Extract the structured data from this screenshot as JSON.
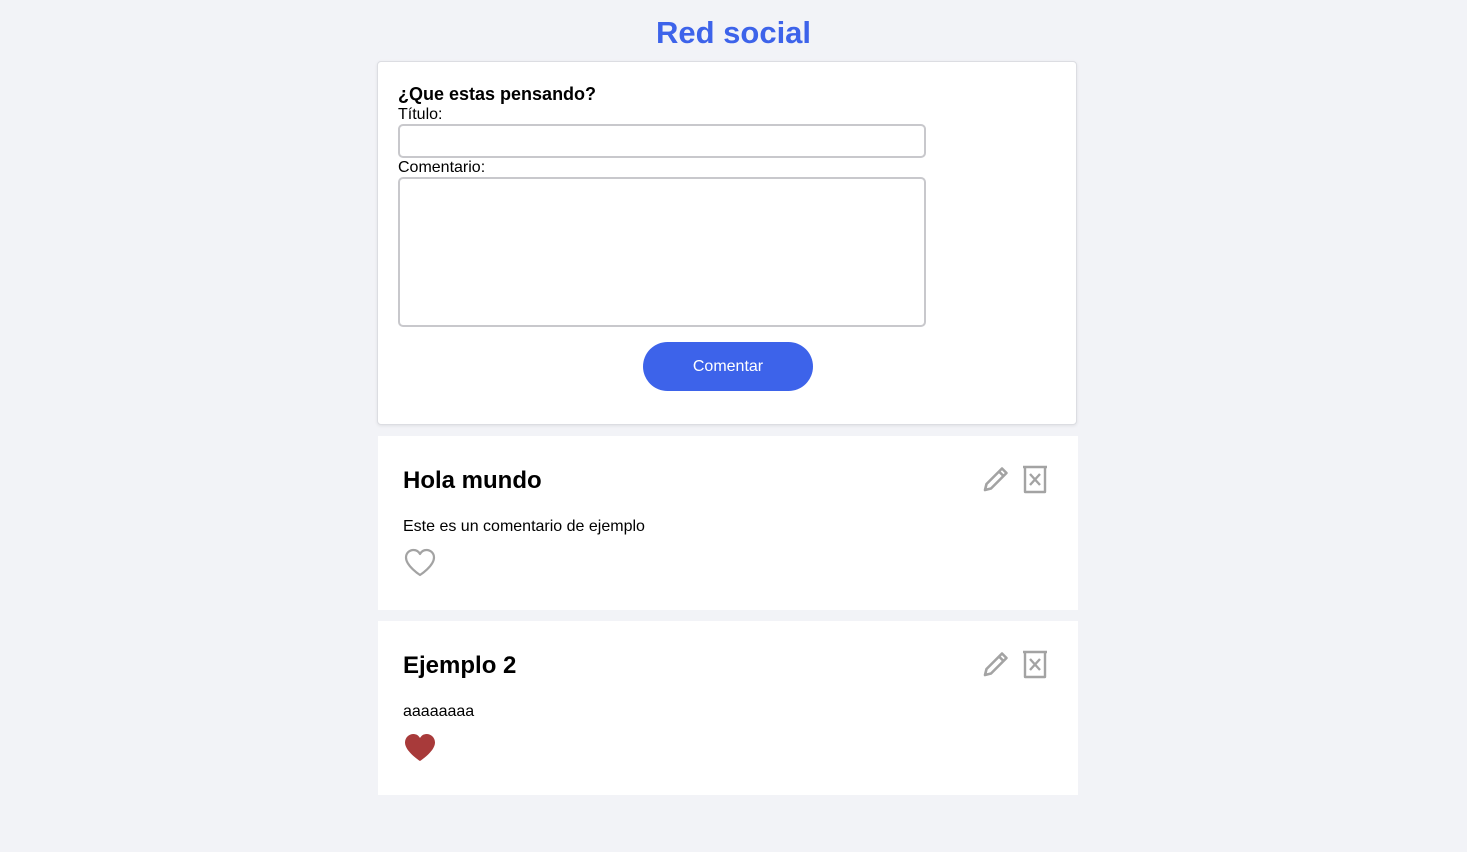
{
  "app": {
    "title": "Red social",
    "accent_color": "#3d63ea"
  },
  "form": {
    "heading": "¿Que estas pensando?",
    "title_label": "Título:",
    "title_value": "",
    "comment_label": "Comentario:",
    "comment_value": "",
    "submit_label": "Comentar"
  },
  "posts": [
    {
      "title": "Hola mundo",
      "body": "Este es un comentario de ejemplo",
      "liked": false,
      "icons": [
        "pencil-icon",
        "trash-icon",
        "heart-outline-icon"
      ]
    },
    {
      "title": "Ejemplo 2",
      "body": "aaaaaaaa",
      "liked": true,
      "like_color": "#a83a3a",
      "icons": [
        "pencil-icon",
        "trash-icon",
        "heart-filled-icon"
      ]
    }
  ]
}
